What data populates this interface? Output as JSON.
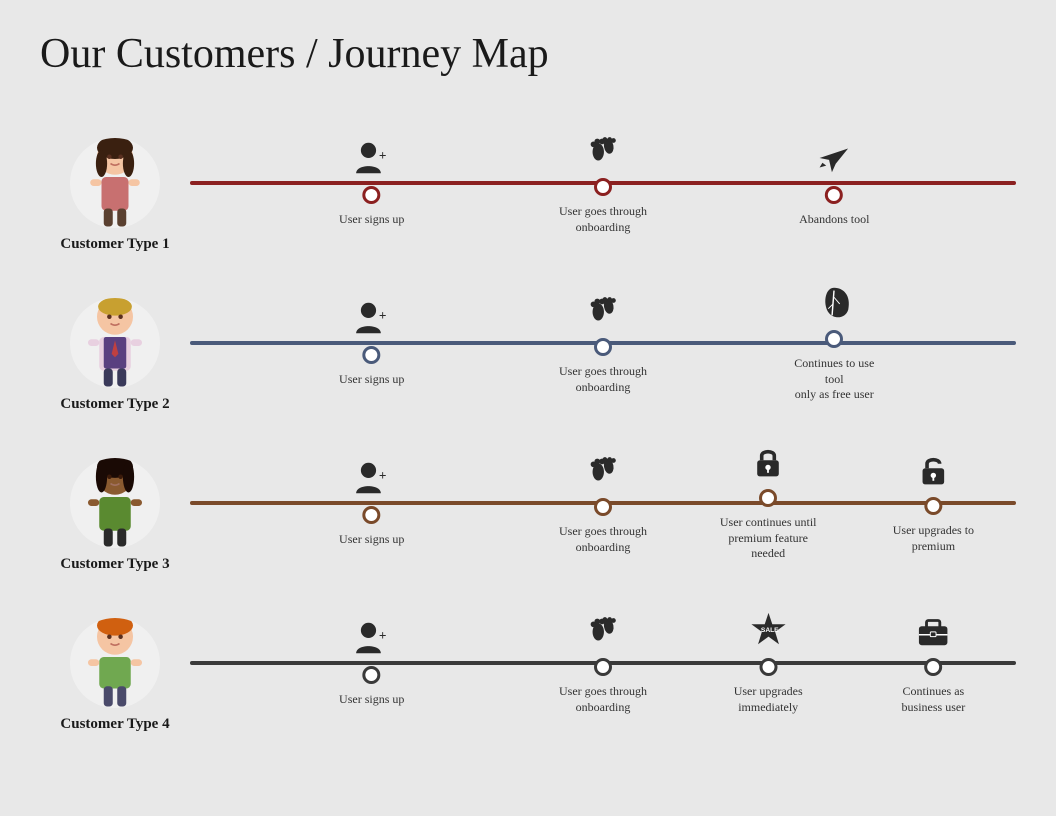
{
  "title": {
    "main": "Our Customers",
    "sub": " / Journey Map"
  },
  "rows": [
    {
      "id": "row1",
      "colorClass": "row1",
      "customerLabel": "Customer Type 1",
      "steps": [
        {
          "left": "22%",
          "icon": "signup",
          "label": "User signs up"
        },
        {
          "left": "50%",
          "icon": "feet",
          "label": "User goes through\nonboarding"
        },
        {
          "left": "78%",
          "icon": "plane",
          "label": "Abandons tool"
        }
      ]
    },
    {
      "id": "row2",
      "colorClass": "row2",
      "customerLabel": "Customer Type 2",
      "steps": [
        {
          "left": "22%",
          "icon": "signup",
          "label": "User signs up"
        },
        {
          "left": "50%",
          "icon": "feet",
          "label": "User goes through\nonboarding"
        },
        {
          "left": "78%",
          "icon": "leaf",
          "label": "Continues to use tool\nonly as free user"
        }
      ]
    },
    {
      "id": "row3",
      "colorClass": "row3",
      "customerLabel": "Customer Type 3",
      "steps": [
        {
          "left": "22%",
          "icon": "signup",
          "label": "User signs up"
        },
        {
          "left": "50%",
          "icon": "feet",
          "label": "User goes through\nonboarding"
        },
        {
          "left": "70%",
          "icon": "lock-closed",
          "label": "User continues until\npremium feature needed"
        },
        {
          "left": "90%",
          "icon": "lock-open",
          "label": "User upgrades to\npremium"
        }
      ]
    },
    {
      "id": "row4",
      "colorClass": "row4",
      "customerLabel": "Customer Type 4",
      "steps": [
        {
          "left": "22%",
          "icon": "signup",
          "label": "User signs up"
        },
        {
          "left": "50%",
          "icon": "feet",
          "label": "User goes through\nonboarding"
        },
        {
          "left": "70%",
          "icon": "sale",
          "label": "User upgrades\nimmediately"
        },
        {
          "left": "90%",
          "icon": "briefcase",
          "label": "Continues as\nbusiness user"
        }
      ]
    }
  ]
}
